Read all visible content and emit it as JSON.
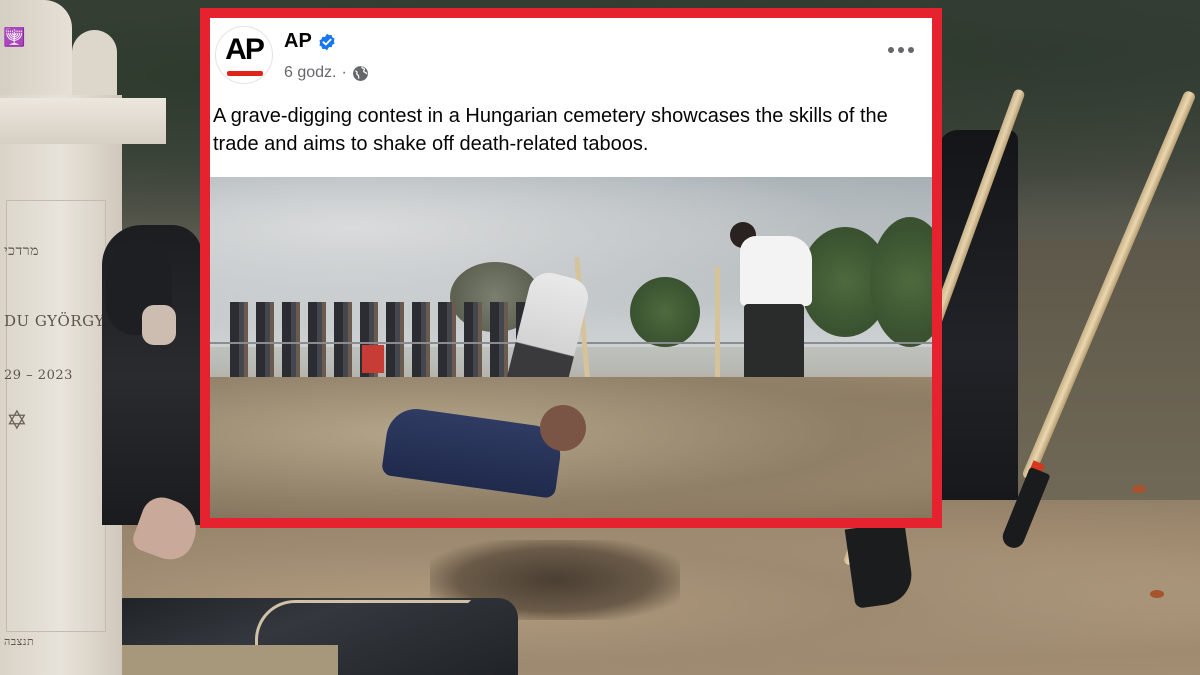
{
  "post": {
    "author": "AP",
    "avatar_text": "AP",
    "time": "6 godz.",
    "separator": "·",
    "caption": "A grave-digging contest in a Hungarian cemetery showcases the skills of the trade and aims to shake off death-related taboos.",
    "icons": {
      "verified": "verified-badge-icon",
      "audience": "globe-icon",
      "more": "more-options-icon"
    }
  },
  "background": {
    "tombstone_name": "DU GYÖRGY",
    "tombstone_years": "29 – 2023",
    "tombstone_hebrew": "מרדכי",
    "tombstone_bottom": "תנצבה"
  },
  "colors": {
    "frame_red": "#e6222e",
    "verified_blue": "#1877f2",
    "ap_red": "#e2231a"
  }
}
